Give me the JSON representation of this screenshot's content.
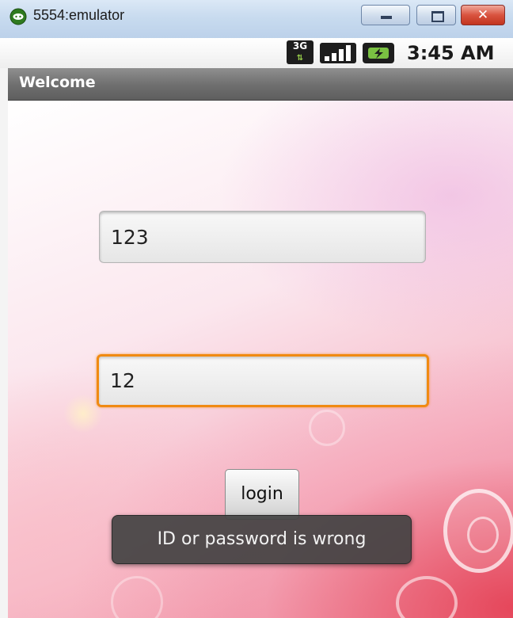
{
  "window": {
    "title": "5554:emulator",
    "close_label": "✕"
  },
  "status_bar": {
    "network_type": "3G",
    "time": "3:45 AM"
  },
  "app": {
    "title": "Welcome",
    "id_field_value": "123",
    "password_field_value": "12",
    "login_label": "login",
    "toast_message": "ID or password is wrong"
  },
  "colors": {
    "focus_border": "#f08a12",
    "title_bar": "#6e6e6e",
    "toast_bg": "#424242"
  },
  "icons": [
    "android-emulator-icon",
    "minimize-icon",
    "maximize-icon",
    "close-icon",
    "network-3g-icon",
    "signal-strength-icon",
    "battery-icon"
  ]
}
